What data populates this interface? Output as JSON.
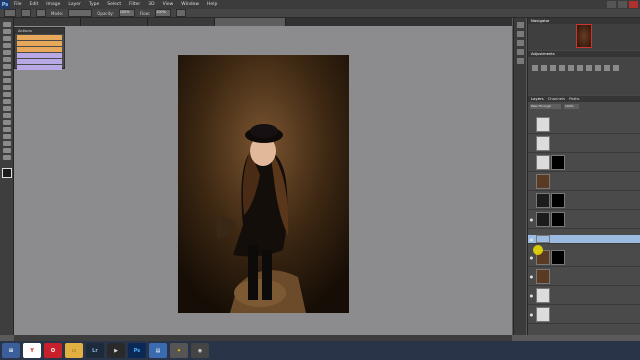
{
  "menubar": {
    "logo": "Ps",
    "items": [
      "File",
      "Edit",
      "Image",
      "Layer",
      "Type",
      "Select",
      "Filter",
      "3D",
      "View",
      "Window",
      "Help"
    ]
  },
  "options": {
    "mode_label": "Mode:",
    "opacity_label": "Opacity:",
    "opacity_value": "100%",
    "flow_label": "Flow:",
    "flow_value": "100%"
  },
  "tabs": [
    {
      "label": "",
      "active": false
    },
    {
      "label": "",
      "active": false
    },
    {
      "label": "",
      "active": false
    },
    {
      "label": "",
      "active": true
    }
  ],
  "actions_panel": {
    "title": "Actions",
    "rows": [
      {
        "label": "",
        "color": "#e8a85c"
      },
      {
        "label": "",
        "color": "#e8a85c"
      },
      {
        "label": "",
        "color": "#e8a85c"
      },
      {
        "label": "",
        "color": "#b9a8e6"
      },
      {
        "label": "",
        "color": "#b9a8e6"
      },
      {
        "label": "",
        "color": "#b9a8e6"
      }
    ]
  },
  "navigator": {
    "title": "Navigator"
  },
  "adjustments": {
    "title": "Adjustments"
  },
  "layers_panel": {
    "tabs": [
      "Layers",
      "Channels",
      "Paths"
    ],
    "blend_mode": "Pass Through",
    "opacity_value": "100%",
    "layers": [
      {
        "name": "",
        "thumb": "#dcdcdc",
        "mask": false,
        "selected": false,
        "visible": false
      },
      {
        "name": "",
        "thumb": "#dcdcdc",
        "mask": false,
        "selected": false,
        "visible": false
      },
      {
        "name": "",
        "thumb": "#dcdcdc",
        "mask": true,
        "selected": false,
        "visible": false
      },
      {
        "name": "",
        "thumb": "#5a3a22",
        "mask": false,
        "selected": false,
        "visible": false
      },
      {
        "name": "",
        "thumb": "#1c1c1c",
        "mask": true,
        "selected": false,
        "visible": false
      },
      {
        "name": "",
        "thumb": "#1c1c1c",
        "mask": true,
        "selected": false,
        "visible": true
      },
      {
        "name": "",
        "thumb": "#9bbbe0",
        "mask": false,
        "selected": true,
        "visible": true
      },
      {
        "name": "",
        "thumb": "#5a3a22",
        "mask": true,
        "selected": false,
        "visible": true
      },
      {
        "name": "",
        "thumb": "#5a3a22",
        "mask": false,
        "selected": false,
        "visible": true
      },
      {
        "name": "",
        "thumb": "#dcdcdc",
        "mask": false,
        "selected": false,
        "visible": true
      },
      {
        "name": "",
        "thumb": "#dcdcdc",
        "mask": false,
        "selected": false,
        "visible": true
      }
    ]
  },
  "taskbar": {
    "apps": [
      {
        "icon": "windows-start-icon",
        "glyph": "⊞",
        "bg": "#3a5f9a",
        "fg": "#fff"
      },
      {
        "icon": "yandex-browser-icon",
        "glyph": "Y",
        "bg": "#ffffff",
        "fg": "#d22"
      },
      {
        "icon": "opera-icon",
        "glyph": "O",
        "bg": "#c8202a",
        "fg": "#fff"
      },
      {
        "icon": "folder-icon",
        "glyph": "▭",
        "bg": "#e0b040",
        "fg": "#6a4a10"
      },
      {
        "icon": "lightroom-icon",
        "glyph": "Lr",
        "bg": "#1c2a3a",
        "fg": "#8cb4e0"
      },
      {
        "icon": "player-icon",
        "glyph": "▶",
        "bg": "#2a2a2a",
        "fg": "#ddd"
      },
      {
        "icon": "photoshop-icon",
        "glyph": "Ps",
        "bg": "#0a2a55",
        "fg": "#4ab0ff"
      },
      {
        "icon": "document-icon",
        "glyph": "▤",
        "bg": "#3a6ab0",
        "fg": "#fff"
      },
      {
        "icon": "app-icon",
        "glyph": "✦",
        "bg": "#555",
        "fg": "#fc0"
      },
      {
        "icon": "media-icon",
        "glyph": "◉",
        "bg": "#444",
        "fg": "#ddd"
      }
    ],
    "time": "",
    "date": ""
  },
  "colors": {
    "canvas_bg": "#8c8c8f",
    "panel_bg": "#474747",
    "selected_layer": "#9bbbe0"
  }
}
